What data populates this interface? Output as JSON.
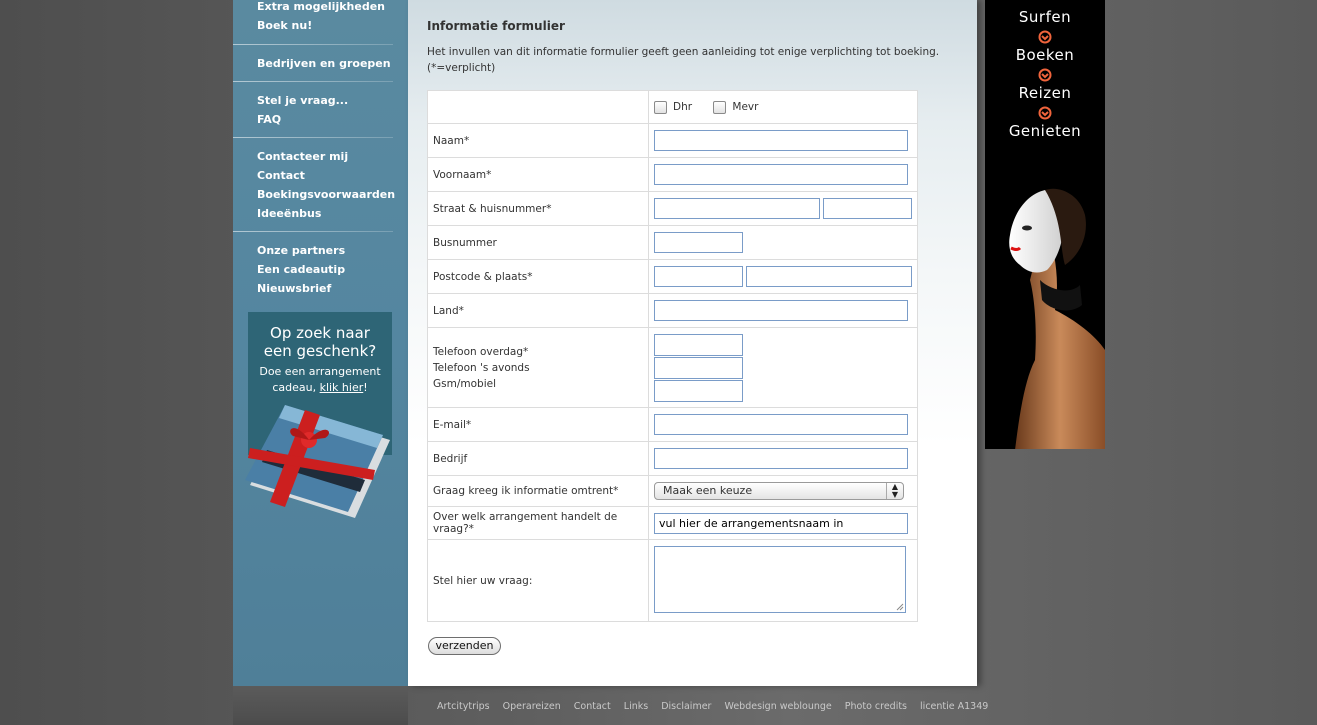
{
  "sidebar": {
    "group1": [
      "Extra mogelijkheden",
      "Boek nu!"
    ],
    "group2": [
      "Bedrijven en groepen"
    ],
    "group3": [
      "Stel je vraag...",
      "FAQ"
    ],
    "group4": [
      "Contacteer mij",
      "Contact",
      "Boekingsvoorwaarden",
      "Ideeënbus"
    ],
    "group5": [
      "Onze partners",
      "Een cadeautip",
      "Nieuwsbrief"
    ],
    "gift": {
      "title_line1": "Op zoek naar",
      "title_line2": "een geschenk?",
      "sub_line1": "Doe een arrangement",
      "sub_pre": "cadeau, ",
      "sub_link": "klik hier",
      "sub_post": "!"
    }
  },
  "form": {
    "title": "Informatie formulier",
    "intro": "Het invullen van dit informatie formulier geeft geen aanleiding tot enige verplichting tot boeking. (*=verplicht)",
    "salutation": {
      "option1": "Dhr",
      "option2": "Mevr"
    },
    "labels": {
      "naam": "Naam*",
      "voornaam": "Voornaam*",
      "straat": "Straat & huisnummer*",
      "busnummer": "Busnummer",
      "postcode": "Postcode & plaats*",
      "land": "Land*",
      "tel_dag": "Telefoon overdag*",
      "tel_avond": "Telefoon 's avonds",
      "gsm": "Gsm/mobiel",
      "email": "E-mail*",
      "bedrijf": "Bedrijf",
      "info": "Graag kreeg ik informatie omtrent*",
      "arrangement": "Over welk arrangement handelt de vraag?*",
      "vraag": "Stel hier uw vraag:"
    },
    "select_value": "Maak een keuze",
    "arrangement_value": "vul hier de arrangementsnaam in",
    "submit": "verzenden"
  },
  "ad": {
    "words": [
      "Surfen",
      "Boeken",
      "Reizen",
      "Genieten"
    ],
    "accent_color": "#f0643c"
  },
  "footer": {
    "links": [
      "Artcitytrips",
      "Operareizen",
      "Contact",
      "Links",
      "Disclaimer",
      "Webdesign weblounge",
      "Photo credits",
      "licentie A1349"
    ]
  }
}
